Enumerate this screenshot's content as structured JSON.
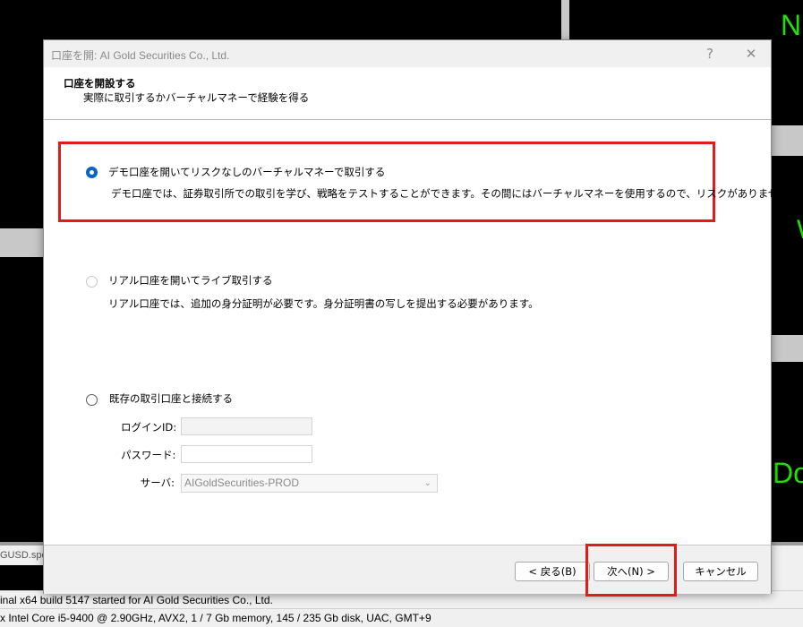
{
  "background": {
    "right_texts": [
      "N",
      "W",
      "Do"
    ],
    "tab_label": "GUSD.spot",
    "log_lines": [
      "inal x64 build 5147 started for AI Gold Securities Co., Ltd.",
      "x Intel Core i5-9400  @ 2.90GHz, AVX2, 1 / 7 Gb memory, 145 / 235 Gb disk, UAC, GMT+9"
    ]
  },
  "dialog": {
    "title": "口座を開: AI Gold Securities Co., Ltd.",
    "help_glyph": "?",
    "close_glyph": "✕",
    "header_title": "口座を開設する",
    "header_subtitle": "実際に取引するかバーチャルマネーで経験を得る",
    "options": [
      {
        "label": "デモ口座を開いてリスクなしのバーチャルマネーで取引する",
        "description": "デモ口座では、証券取引所での取引を学び、戦略をテストすることができます。その間にはバーチャルマネーを使用するので、リスクがありません。",
        "checked": true
      },
      {
        "label": "リアル口座を開いてライブ取引する",
        "description": "リアル口座では、追加の身分証明が必要です。身分証明書の写しを提出する必要があります。",
        "checked": false
      },
      {
        "label": "既存の取引口座と接続する",
        "description": "",
        "checked": false
      }
    ],
    "login_label": "ログインID:",
    "login_value": "",
    "password_label": "パスワード:",
    "password_value": "",
    "server_label": "サーバ:",
    "server_value": "AIGoldSecurities-PROD",
    "back_button": "< 戻る(B)",
    "next_button": "次へ(N) >",
    "cancel_button": "キャンセル"
  },
  "colors": {
    "highlight": "#e01b1b",
    "radio_checked": "#0a62c4",
    "terminal_green": "#22e000"
  }
}
